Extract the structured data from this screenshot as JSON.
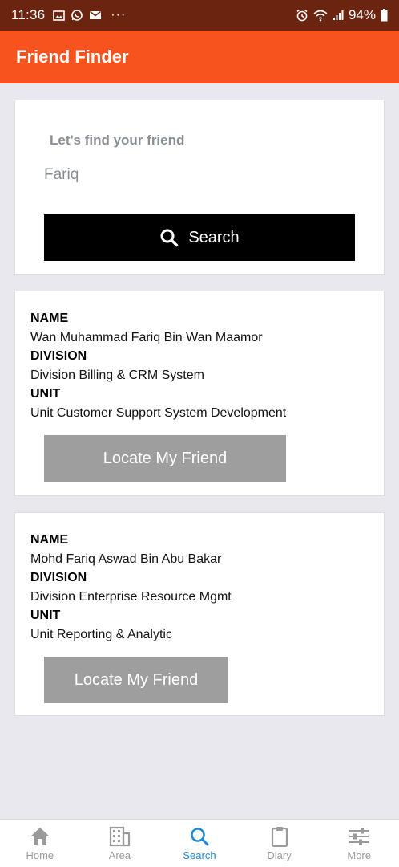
{
  "status_bar": {
    "time": "11:36",
    "battery": "94%"
  },
  "app": {
    "title": "Friend Finder",
    "colors": {
      "appbar": "#f7531f",
      "statusbar": "#6b2410",
      "active_tab": "#1e88d8"
    }
  },
  "search": {
    "label": "Let's find your friend",
    "value": "Fariq",
    "button_label": "Search"
  },
  "results": [
    {
      "name_heading": "NAME",
      "name": "Wan Muhammad Fariq Bin Wan Maamor",
      "division_heading": "DIVISION",
      "division": "Division Billing & CRM System",
      "unit_heading": "UNIT",
      "unit": "Unit Customer Support System Development",
      "button_label": "Locate My Friend"
    },
    {
      "name_heading": "NAME",
      "name": "Mohd Fariq Aswad Bin Abu Bakar",
      "division_heading": "DIVISION",
      "division": "Division Enterprise Resource Mgmt",
      "unit_heading": "UNIT",
      "unit": "Unit Reporting & Analytic",
      "button_label": "Locate My Friend"
    }
  ],
  "bottom_nav": {
    "items": [
      {
        "label": "Home",
        "icon": "home-icon"
      },
      {
        "label": "Area",
        "icon": "building-icon"
      },
      {
        "label": "Search",
        "icon": "search-icon",
        "active": true
      },
      {
        "label": "Diary",
        "icon": "clipboard-icon"
      },
      {
        "label": "More",
        "icon": "sliders-icon"
      }
    ]
  }
}
